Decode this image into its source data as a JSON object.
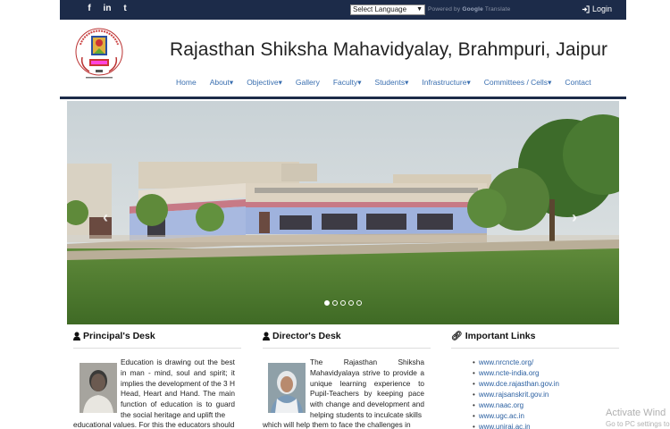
{
  "topbar": {
    "social": [
      "f",
      "in",
      "t"
    ],
    "language_select": "Select Language",
    "powered_prefix": "Powered by",
    "powered_brand": "Google",
    "powered_suffix": "Translate",
    "login_label": "Login"
  },
  "header": {
    "title": "Rajasthan Shiksha Mahavidyalay, Brahmpuri, Jaipur"
  },
  "nav": [
    {
      "label": "Home"
    },
    {
      "label": "About"
    },
    {
      "label": "Objective"
    },
    {
      "label": "Gallery"
    },
    {
      "label": "Faculty"
    },
    {
      "label": "Students"
    },
    {
      "label": "Infrastructure"
    },
    {
      "label": "Committees / Cells"
    },
    {
      "label": "Contact"
    }
  ],
  "slider": {
    "slides": 5,
    "active_slide": 1
  },
  "principal": {
    "title": "Principal's Desk",
    "text_side": "Education is drawing out the best in man - mind, soul and spirit; it implies the development of the 3 H Head, Heart and Hand. The main function of education is to guard the social heritage and uplift the",
    "text_full": "educational values. For this the educators should"
  },
  "director": {
    "title": "Director's Desk",
    "text_side": "The Rajasthan Shiksha Mahavidyalaya strive to provide a unique learning experience to Pupil-Teachers by keeping pace with change and development and helping students to inculcate skills",
    "text_full": "which will help them to face the challenges in"
  },
  "important_links": {
    "title": "Important Links",
    "items": [
      "www.nrcncte.org/",
      "www.ncte-india.org",
      "www.dce.rajasthan.gov.in",
      "www.rajsanskrit.gov.in",
      "www.naac.org",
      "www.ugc.ac.in",
      "www.uniraj.ac.in"
    ]
  },
  "watermark": {
    "line1": "Activate Wind",
    "line2": "Go to PC settings to"
  },
  "colors": {
    "topbar": "#1c2b49",
    "nav_link": "#3a6fb0",
    "link": "#2a5fa0"
  }
}
